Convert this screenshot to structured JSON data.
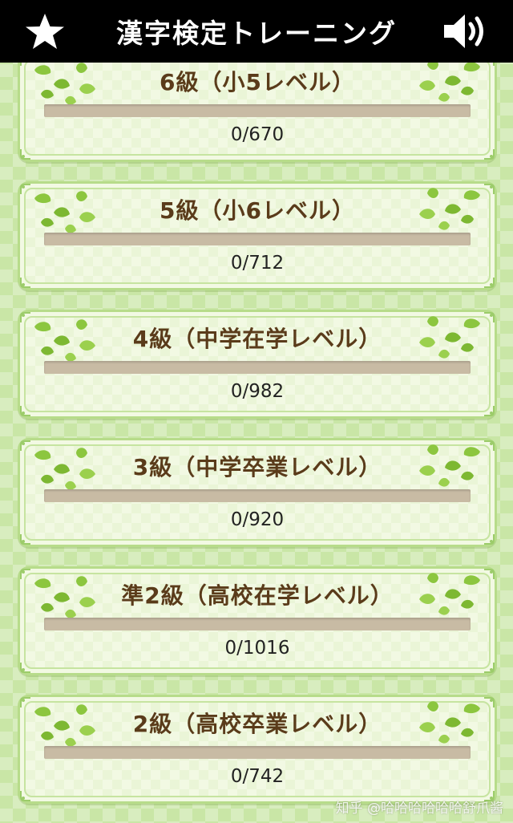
{
  "header": {
    "title": "漢字検定トレーニング",
    "left_icon": "star-icon",
    "right_icon": "speaker-icon"
  },
  "levels": [
    {
      "label": "6級（小5レベル）",
      "count": "0/670",
      "progress": 0
    },
    {
      "label": "5級（小6レベル）",
      "count": "0/712",
      "progress": 0
    },
    {
      "label": "4級（中学在学レベル）",
      "count": "0/982",
      "progress": 0
    },
    {
      "label": "3級（中学卒業レベル）",
      "count": "0/920",
      "progress": 0
    },
    {
      "label": "準2級（高校在学レベル）",
      "count": "0/1016",
      "progress": 0
    },
    {
      "label": "2級（高校卒業レベル）",
      "count": "0/742",
      "progress": 0
    }
  ],
  "watermark": "知乎 @哈哈哈哈哈哈舒爪酱",
  "colors": {
    "header_bg": "#000000",
    "background": "#c9e6a6",
    "card_bg": "#f2f9e3",
    "label_text": "#5a3b1a",
    "leaf": "#8cc63f"
  }
}
